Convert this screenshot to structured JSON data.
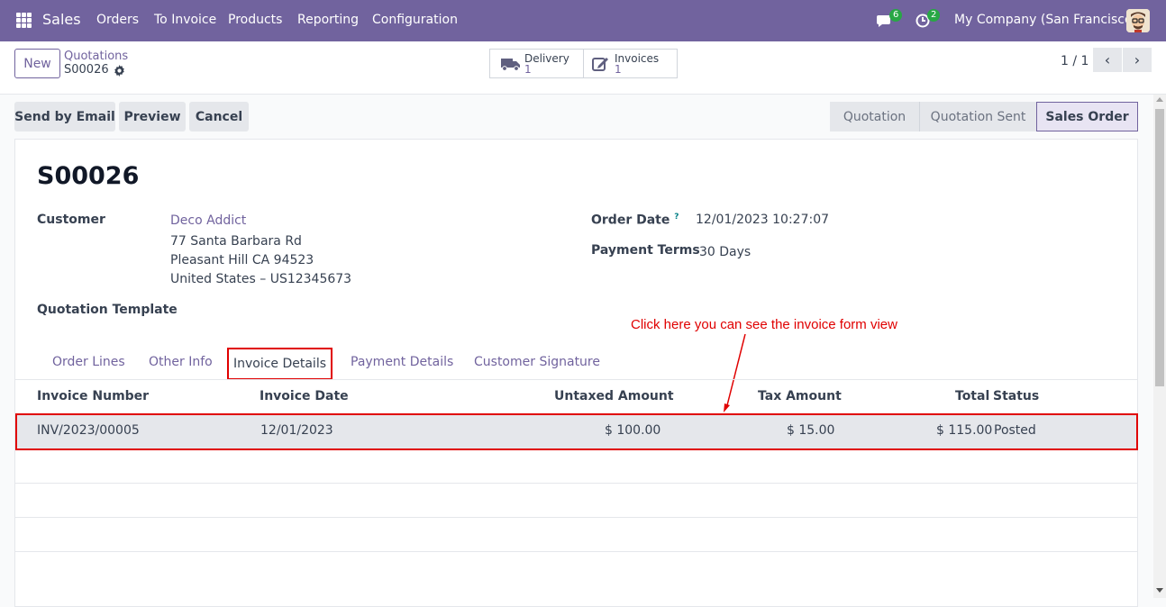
{
  "nav": {
    "app": "Sales",
    "menu": [
      "Orders",
      "To Invoice",
      "Products",
      "Reporting",
      "Configuration"
    ],
    "messages_count": "6",
    "activities_count": "2",
    "company": "My Company (San Francisco)"
  },
  "control": {
    "new_label": "New",
    "breadcrumb_parent": "Quotations",
    "breadcrumb_current": "S00026",
    "delivery_label": "Delivery",
    "delivery_count": "1",
    "invoices_label": "Invoices",
    "invoices_count": "1",
    "pager": "1 / 1"
  },
  "actions": {
    "send_email": "Send by Email",
    "preview": "Preview",
    "cancel": "Cancel"
  },
  "status": {
    "stages": [
      "Quotation",
      "Quotation Sent",
      "Sales Order"
    ],
    "active": "Sales Order"
  },
  "form": {
    "title": "S00026",
    "customer_label": "Customer",
    "customer_name": "Deco Addict",
    "address_line1": "77 Santa Barbara Rd",
    "address_line2": "Pleasant Hill CA 94523",
    "address_line3": "United States – US12345673",
    "template_label": "Quotation Template",
    "order_date_label": "Order Date",
    "order_date_help": "?",
    "order_date": "12/01/2023 10:27:07",
    "payment_terms_label": "Payment Terms",
    "payment_terms": "30 Days"
  },
  "annotation": "Click here you can see the invoice form view",
  "tabs": [
    "Order Lines",
    "Other Info",
    "Invoice Details",
    "Payment Details",
    "Customer Signature"
  ],
  "table": {
    "headers": [
      "Invoice Number",
      "Invoice Date",
      "Untaxed Amount",
      "Tax Amount",
      "Total",
      "Status"
    ],
    "rows": [
      [
        "INV/2023/00005",
        "12/01/2023",
        "$ 100.00",
        "$ 15.00",
        "$ 115.00",
        "Posted"
      ]
    ]
  },
  "colors": {
    "brand": "#71639e",
    "highlight": "#e00000",
    "badge": "#28a745"
  }
}
